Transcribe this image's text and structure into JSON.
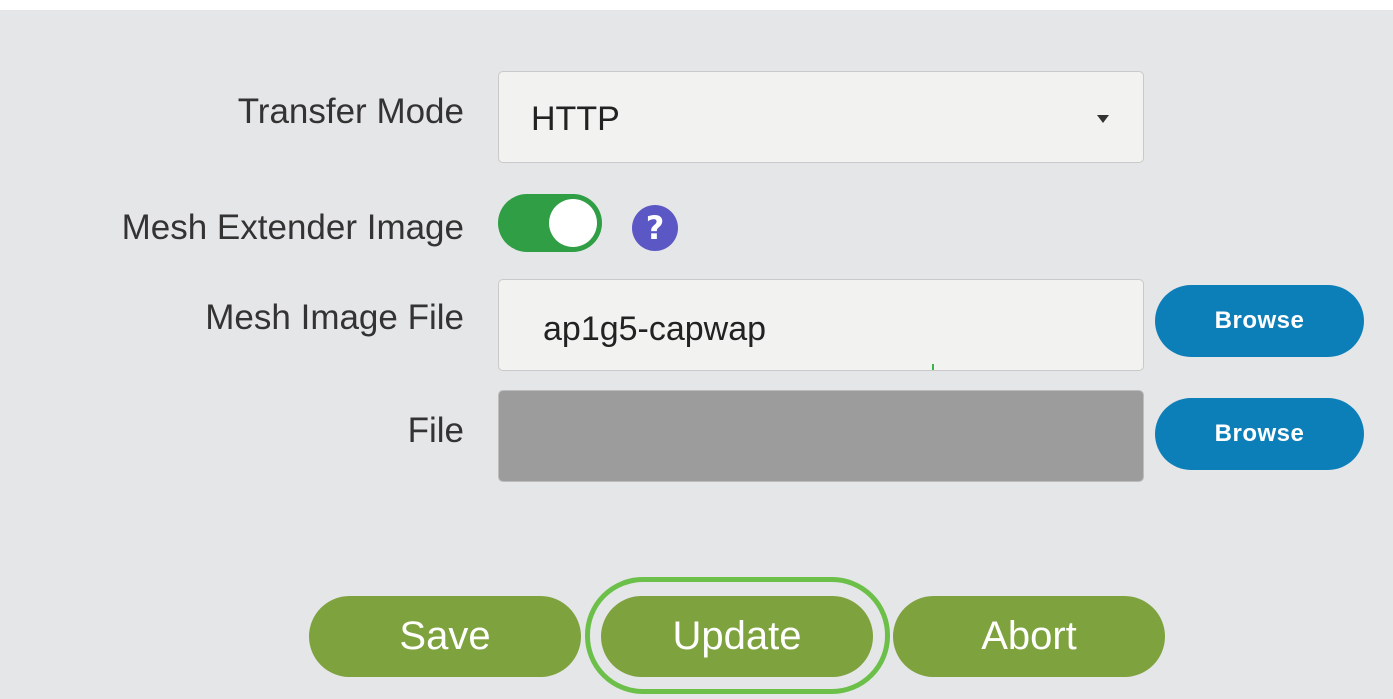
{
  "form": {
    "transfer_mode": {
      "label": "Transfer Mode",
      "selected": "HTTP"
    },
    "mesh_extender_image": {
      "label": "Mesh Extender Image",
      "toggle_on": true,
      "help_glyph": "?",
      "toggle_color": "#2f9e44"
    },
    "mesh_image_file": {
      "label": "Mesh Image File",
      "value": "ap1g5-capwap",
      "browse_label": "Browse"
    },
    "file": {
      "label": "File",
      "value": "",
      "browse_label": "Browse"
    }
  },
  "actions": {
    "save_label": "Save",
    "update_label": "Update",
    "abort_label": "Abort",
    "highlighted": "update"
  },
  "colors": {
    "action_button": "#7ea23d",
    "browse_button": "#0d7fb8",
    "help_icon": "#5b58c6",
    "highlight_ring": "#6cc04a"
  },
  "icons": {
    "dropdown": "chevron-down-icon",
    "help": "question-mark-icon"
  }
}
